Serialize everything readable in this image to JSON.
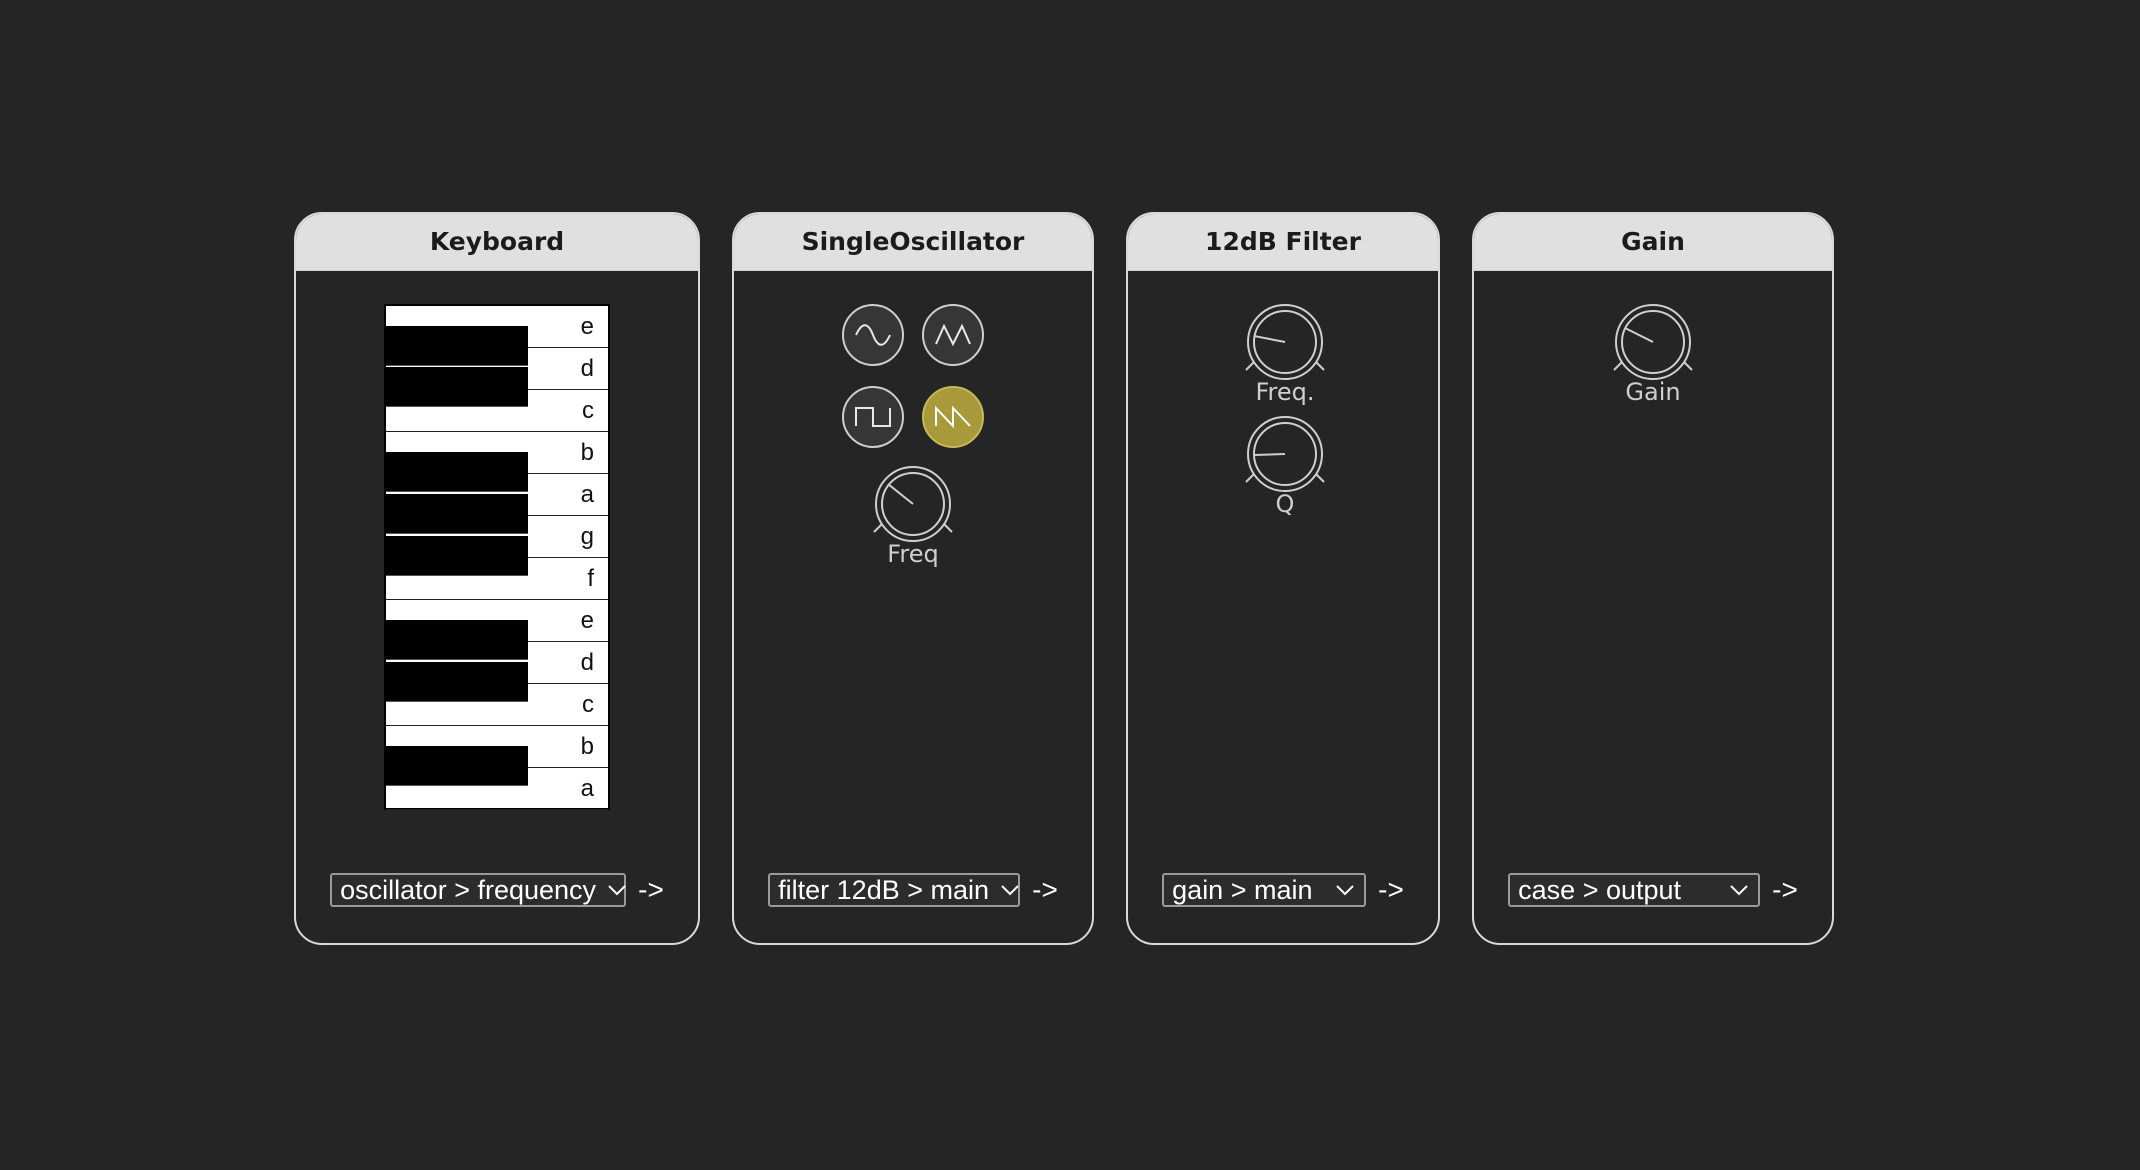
{
  "modules": [
    {
      "title": "Keyboard",
      "keys": [
        "e",
        "d",
        "c",
        "b",
        "a",
        "g",
        "f",
        "e",
        "d",
        "c",
        "b",
        "a"
      ],
      "route": "oscillator > frequency",
      "route_arrow": "->"
    },
    {
      "title": "SingleOscillator",
      "waveforms": [
        "sine-wave-icon",
        "triangle-wave-icon",
        "square-wave-icon",
        "sawtooth-wave-icon"
      ],
      "selected_waveform": "sawtooth-wave-icon",
      "knob_label": "Freq",
      "route": "filter 12dB > main",
      "route_arrow": "->"
    },
    {
      "title": "12dB Filter",
      "knob1_label": "Freq.",
      "knob2_label": "Q",
      "route": "gain > main",
      "route_arrow": "->"
    },
    {
      "title": "Gain",
      "knob_label": "Gain",
      "route": "case > output",
      "route_arrow": "->"
    }
  ],
  "colors": {
    "background": "#252525",
    "header": "#e0e0e0",
    "selected_wave": "#a89a3a"
  }
}
